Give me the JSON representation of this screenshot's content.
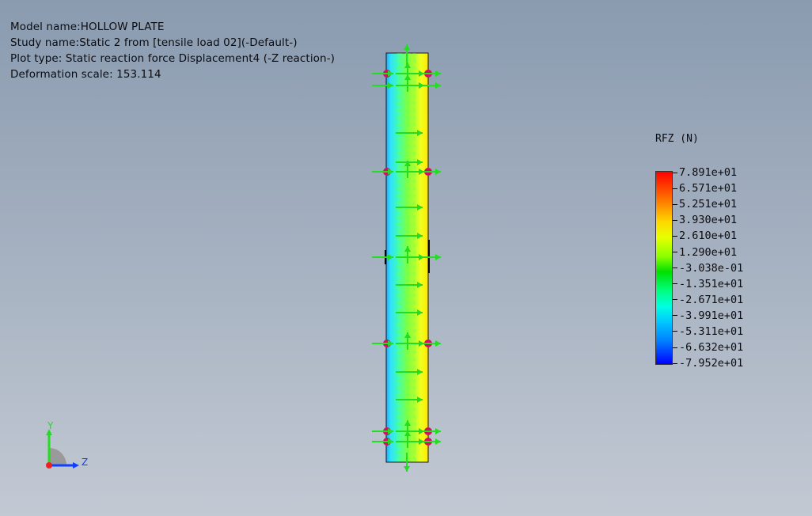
{
  "info": {
    "model_name": "Model name:HOLLOW PLATE",
    "study_name": "Study name:Static 2 from [tensile load 02](-Default-)",
    "plot_type": "Plot type: Static reaction force Displacement4 (-Z reaction-)",
    "deformation_scale": "Deformation scale: 153.114"
  },
  "legend": {
    "title": "RFZ  (N)",
    "values": [
      "7.891e+01",
      "6.571e+01",
      "5.251e+01",
      "3.930e+01",
      "2.610e+01",
      "1.290e+01",
      "-3.038e-01",
      "-1.351e+01",
      "-2.671e+01",
      "-3.991e+01",
      "-5.311e+01",
      "-6.632e+01",
      "-7.952e+01"
    ]
  },
  "triad": {
    "y_label": "Y",
    "z_label": "Z"
  },
  "colors": {
    "arrow": "#22dd22",
    "fixture": "#d01060",
    "plate_edge": "#1a1a1a"
  }
}
